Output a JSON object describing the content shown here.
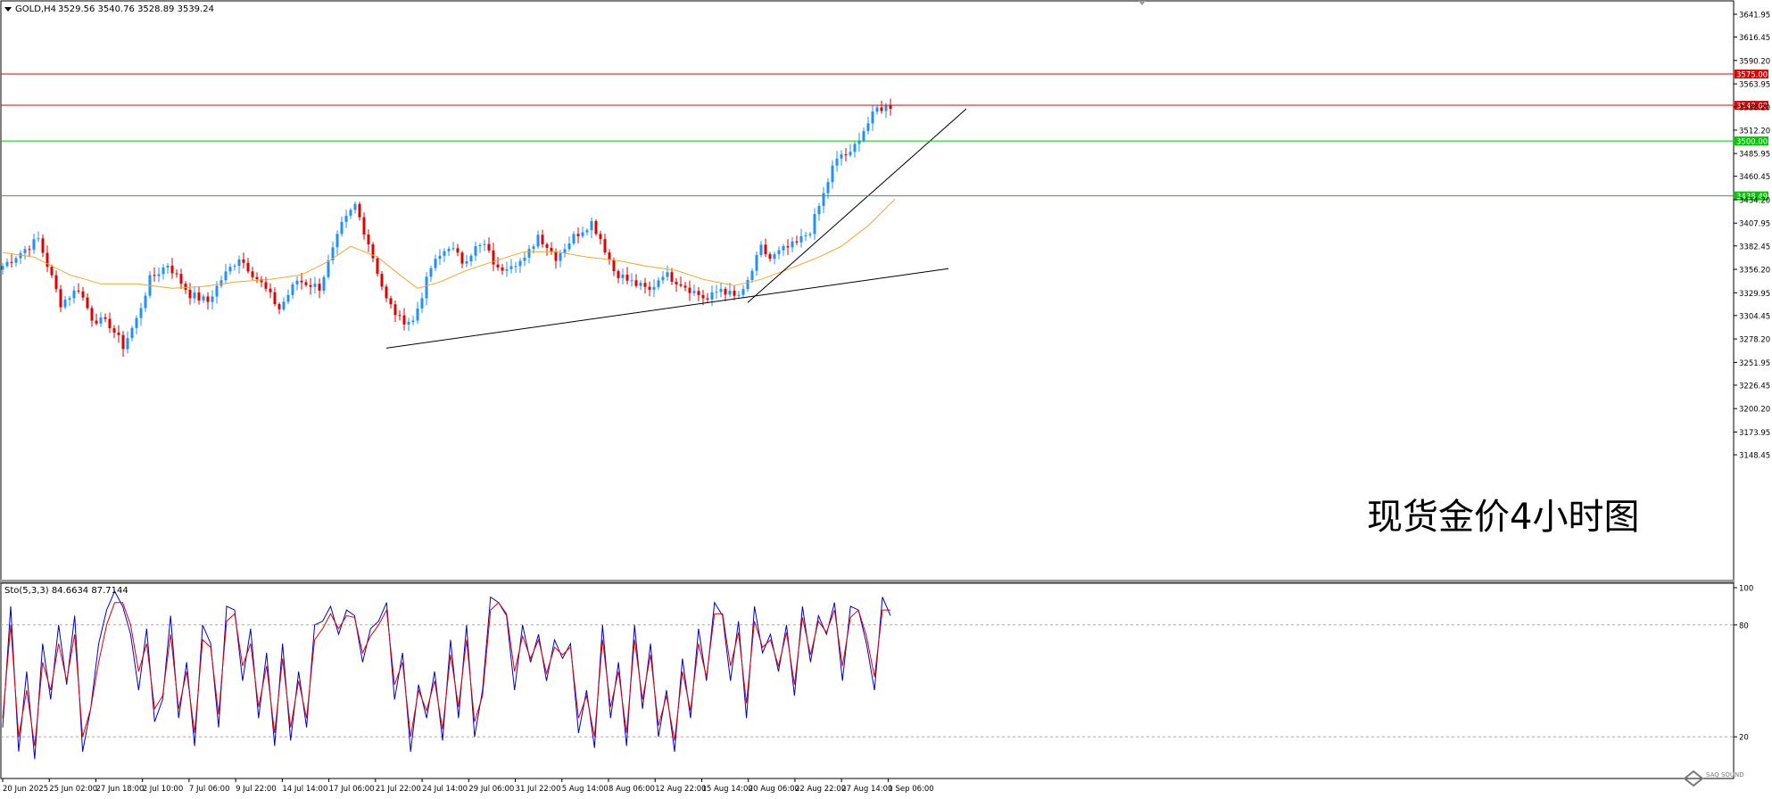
{
  "header": {
    "symbol": "GOLD,H4",
    "ohlc": "3529.56 3540.76 3528.89 3539.24",
    "indicator": "Sto(5,3,3) 84.6634 87.7144"
  },
  "watermark": "现货金价4小时图",
  "brand": "SAQ SOUND",
  "colors": {
    "bull": "#1e90ff",
    "bear": "#e00000",
    "ma": "#f5a623",
    "resistance": "#e00000",
    "support": "#00c800",
    "stoch_k": "#0000cc",
    "stoch_d": "#e00000",
    "trend": "#000000"
  },
  "chart_data": [
    {
      "type": "candlestick",
      "title": "",
      "xlabel": "",
      "ylabel": "",
      "ylim": [
        3148.45,
        3654.0
      ],
      "y_ticks": [
        "3641.95",
        "3616.45",
        "3590.20",
        "3563.95",
        "3538.20",
        "3512.20",
        "3485.95",
        "3460.45",
        "3434.20",
        "3407.95",
        "3382.45",
        "3356.20",
        "3329.95",
        "3304.45",
        "3278.20",
        "3251.95",
        "3226.45",
        "3200.20",
        "3173.95",
        "3148.45"
      ],
      "x_ticks": [
        "20 Jun 2025",
        "25 Jun 02:00",
        "27 Jun 18:00",
        "2 Jul 10:00",
        "7 Jul 06:00",
        "9 Jul 22:00",
        "14 Jul 14:00",
        "17 Jul 06:00",
        "21 Jul 22:00",
        "24 Jul 14:00",
        "29 Jul 06:00",
        "31 Jul 22:00",
        "5 Aug 14:00",
        "8 Aug 06:00",
        "12 Aug 22:00",
        "15 Aug 14:00",
        "20 Aug 06:00",
        "22 Aug 22:00",
        "27 Aug 14:00",
        "1 Sep 06:00"
      ],
      "horizontal_levels": [
        {
          "label": "3575.00",
          "value": 3575.0,
          "color": "#e00000"
        },
        {
          "label": "3540.00",
          "value": 3540.0,
          "color": "#e00000"
        },
        {
          "label": "3500.00",
          "value": 3500.0,
          "color": "#00c800"
        },
        {
          "label": "3438.49",
          "value": 3438.49,
          "color": "#00c800"
        }
      ],
      "trendlines": [
        {
          "from": [
            86,
            3268
          ],
          "to": [
            212,
            3357
          ]
        },
        {
          "from": [
            167,
            3319
          ],
          "to": [
            216,
            3536
          ]
        }
      ],
      "close_path": [
        [
          0,
          3360
        ],
        [
          8,
          3390
        ],
        [
          13,
          3318
        ],
        [
          17,
          3335
        ],
        [
          20,
          3302
        ],
        [
          24,
          3294
        ],
        [
          27,
          3270
        ],
        [
          30,
          3300
        ],
        [
          33,
          3345
        ],
        [
          37,
          3362
        ],
        [
          42,
          3328
        ],
        [
          46,
          3320
        ],
        [
          49,
          3345
        ],
        [
          53,
          3370
        ],
        [
          58,
          3340
        ],
        [
          62,
          3312
        ],
        [
          66,
          3344
        ],
        [
          71,
          3336
        ],
        [
          76,
          3405
        ],
        [
          79,
          3428
        ],
        [
          82,
          3386
        ],
        [
          86,
          3322
        ],
        [
          89,
          3300
        ],
        [
          92,
          3298
        ],
        [
          96,
          3358
        ],
        [
          100,
          3383
        ],
        [
          103,
          3365
        ],
        [
          106,
          3380
        ],
        [
          108,
          3383
        ],
        [
          111,
          3355
        ],
        [
          114,
          3364
        ],
        [
          117,
          3366
        ],
        [
          120,
          3395
        ],
        [
          124,
          3370
        ],
        [
          128,
          3393
        ],
        [
          132,
          3409
        ],
        [
          134,
          3391
        ],
        [
          137,
          3355
        ],
        [
          140,
          3344
        ],
        [
          145,
          3332
        ],
        [
          148,
          3352
        ],
        [
          152,
          3341
        ],
        [
          155,
          3331
        ],
        [
          158,
          3322
        ],
        [
          161,
          3335
        ],
        [
          164,
          3325
        ],
        [
          166,
          3330
        ],
        [
          168,
          3355
        ],
        [
          170,
          3380
        ],
        [
          172,
          3368
        ],
        [
          175,
          3378
        ],
        [
          178,
          3385
        ],
        [
          181,
          3400
        ],
        [
          184,
          3440
        ],
        [
          186,
          3470
        ],
        [
          188,
          3485
        ],
        [
          190,
          3484
        ],
        [
          192,
          3505
        ],
        [
          194,
          3520
        ],
        [
          196,
          3536
        ],
        [
          199,
          3539.24
        ]
      ],
      "moving_average": [
        [
          0,
          3375
        ],
        [
          7,
          3370
        ],
        [
          15,
          3350
        ],
        [
          22,
          3340
        ],
        [
          30,
          3340
        ],
        [
          38,
          3335
        ],
        [
          45,
          3337
        ],
        [
          52,
          3342
        ],
        [
          60,
          3345
        ],
        [
          67,
          3350
        ],
        [
          73,
          3365
        ],
        [
          78,
          3382
        ],
        [
          84,
          3370
        ],
        [
          89,
          3350
        ],
        [
          93,
          3335
        ],
        [
          98,
          3342
        ],
        [
          104,
          3355
        ],
        [
          110,
          3365
        ],
        [
          117,
          3376
        ],
        [
          124,
          3376
        ],
        [
          131,
          3370
        ],
        [
          138,
          3366
        ],
        [
          144,
          3360
        ],
        [
          151,
          3355
        ],
        [
          157,
          3345
        ],
        [
          164,
          3338
        ],
        [
          170,
          3345
        ],
        [
          177,
          3358
        ],
        [
          183,
          3370
        ],
        [
          188,
          3382
        ],
        [
          194,
          3405
        ],
        [
          200,
          3435
        ]
      ]
    },
    {
      "type": "line",
      "title": "",
      "ylim": [
        0,
        100
      ],
      "y_ticks": [
        "100",
        "80",
        "20"
      ],
      "levels": [
        80,
        20
      ],
      "series": [
        {
          "values": [
            25,
            90,
            12,
            55,
            8,
            70,
            40,
            80,
            48,
            85,
            12,
            35,
            70,
            88,
            98,
            90,
            75,
            45,
            78,
            28,
            40,
            85,
            30,
            60,
            15,
            80,
            70,
            25,
            90,
            88,
            50,
            78,
            30,
            65,
            15,
            70,
            18,
            55,
            25,
            80,
            82,
            90,
            75,
            88,
            85,
            60,
            78,
            82,
            92,
            40,
            65,
            12,
            48,
            30,
            55,
            18,
            72,
            30,
            80,
            20,
            45,
            95,
            92,
            85,
            45,
            80,
            60,
            75,
            50,
            72,
            62,
            70,
            22,
            45,
            14,
            80,
            30,
            60,
            15,
            80,
            35,
            70,
            20,
            45,
            12,
            62,
            30,
            78,
            50,
            92,
            85,
            50,
            82,
            30,
            90,
            65,
            75,
            55,
            80,
            42,
            90,
            60,
            85,
            75,
            92,
            50,
            90,
            88,
            70,
            45,
            95,
            85
          ]
        },
        {
          "values": [
            30,
            80,
            20,
            45,
            15,
            60,
            45,
            70,
            50,
            75,
            20,
            35,
            60,
            80,
            92,
            92,
            80,
            55,
            70,
            35,
            42,
            75,
            35,
            55,
            22,
            72,
            68,
            32,
            82,
            86,
            58,
            70,
            36,
            58,
            22,
            62,
            25,
            50,
            30,
            72,
            78,
            86,
            78,
            85,
            84,
            65,
            74,
            80,
            88,
            48,
            60,
            20,
            45,
            34,
            50,
            24,
            64,
            36,
            72,
            28,
            42,
            88,
            92,
            86,
            55,
            74,
            62,
            72,
            54,
            68,
            64,
            68,
            30,
            42,
            20,
            72,
            36,
            55,
            22,
            72,
            40,
            64,
            26,
            42,
            18,
            55,
            34,
            70,
            52,
            86,
            86,
            58,
            76,
            38,
            82,
            68,
            72,
            58,
            76,
            48,
            84,
            64,
            82,
            76,
            88,
            58,
            84,
            88,
            74,
            52,
            88,
            88
          ]
        }
      ]
    }
  ]
}
